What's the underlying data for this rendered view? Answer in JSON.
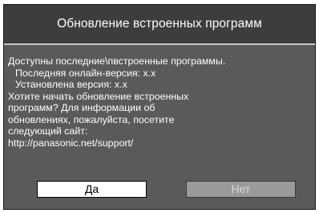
{
  "dialog": {
    "title": "Обновление встроенных программ",
    "lines": [
      "Доступны последние\\пвстроенные программы.",
      "Последняя онлайн-версия: x.x",
      "Установлена версия: x.x",
      "Хотите начать обновление встроенных",
      "программ? Для информации об",
      "обновлениях, пожалуйста, посетите",
      "следующий сайт:",
      "http://panasonic.net/support/"
    ],
    "yes_label": "Да",
    "no_label": "Нет"
  },
  "colors": {
    "dialog_background": "#5a5a5a",
    "title_background": "#3d3d3d",
    "selected_button": "#ffffff",
    "unselected_button": "#9a9a9a"
  }
}
